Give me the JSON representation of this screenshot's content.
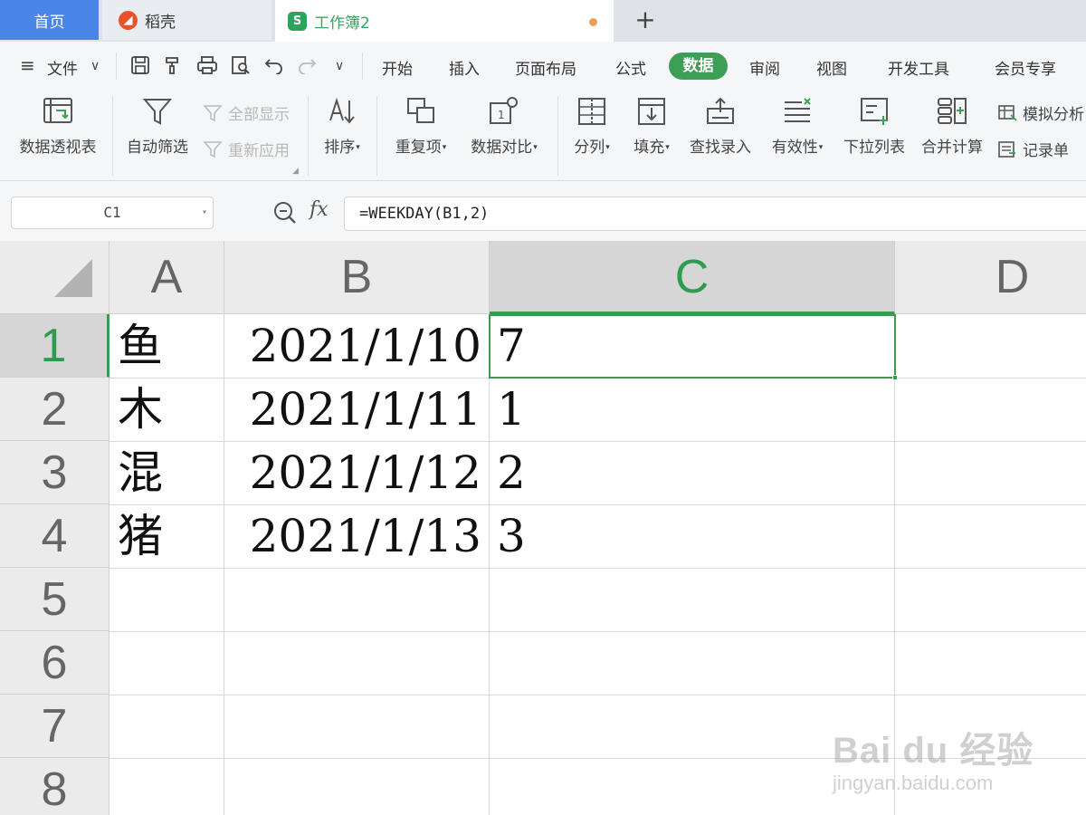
{
  "tabs": {
    "home": "首页",
    "daoke": "稻壳",
    "workbook": "工作簿2",
    "workbook_logo": "S"
  },
  "menu": {
    "file": "文件",
    "items": [
      "开始",
      "插入",
      "页面布局",
      "公式",
      "数据",
      "审阅",
      "视图",
      "开发工具",
      "会员专享"
    ],
    "active": "数据"
  },
  "ribbon": {
    "pivot": "数据透视表",
    "autofilter": "自动筛选",
    "show_all": "全部显示",
    "reapply": "重新应用",
    "sort": "排序",
    "duplicates": "重复项",
    "compare": "数据对比",
    "split": "分列",
    "fill": "填充",
    "lookup_entry": "查找录入",
    "validity": "有效性",
    "dropdown_list": "下拉列表",
    "consolidate": "合并计算",
    "whatif": "模拟分析",
    "form": "记录单"
  },
  "formula_bar": {
    "name_box": "C1",
    "fx": "fx",
    "formula": "=WEEKDAY(B1,2)"
  },
  "sheet": {
    "columns": [
      "A",
      "B",
      "C",
      "D"
    ],
    "selected_column": "C",
    "row_numbers": [
      "1",
      "2",
      "3",
      "4",
      "5",
      "6",
      "7",
      "8"
    ],
    "selected_row": "1",
    "rows": [
      {
        "a": "鱼",
        "b": "2021/1/10",
        "c": "7"
      },
      {
        "a": "木",
        "b": "2021/1/11",
        "c": "1"
      },
      {
        "a": "混",
        "b": "2021/1/12",
        "c": "2"
      },
      {
        "a": "猪",
        "b": "2021/1/13",
        "c": "3"
      }
    ]
  },
  "watermark": {
    "brand": "Bai du 经验",
    "url": "jingyan.baidu.com"
  },
  "colors": {
    "accent_green": "#3d9f55",
    "home_tab_blue": "#4a86e8",
    "modified_dot": "#e8a057"
  }
}
